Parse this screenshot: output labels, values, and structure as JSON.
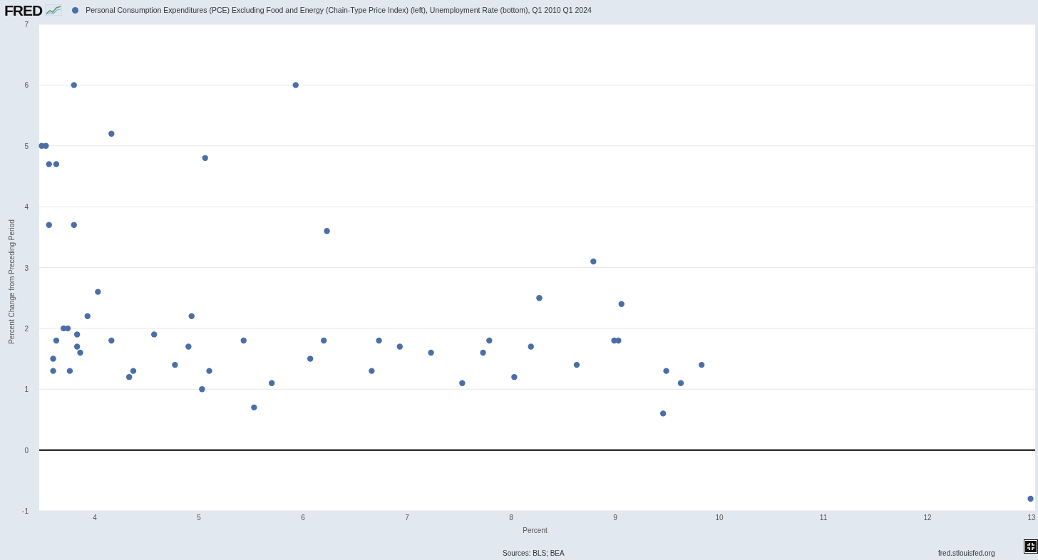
{
  "header": {
    "logo": "FRED",
    "legend": {
      "label": "Personal Consumption Expenditures (PCE) Excluding Food and Energy (Chain-Type Price Index) (left), Unemployment Rate (bottom), Q1 2010 Q1 2024",
      "color": "#4a6ea8"
    }
  },
  "chart_data": {
    "type": "scatter",
    "xlabel": "Percent",
    "ylabel": "Percent Change from Preceding Period",
    "xlim": [
      3.466,
      13.034
    ],
    "ylim": [
      -1,
      7
    ],
    "xticks": [
      4,
      5,
      6,
      7,
      8,
      9,
      10,
      11,
      12,
      13
    ],
    "yticks": [
      -1,
      0,
      1,
      2,
      3,
      4,
      5,
      6,
      7
    ],
    "grid": true,
    "x": [
      3.49,
      3.53,
      3.56,
      3.63,
      3.56,
      3.6,
      3.6,
      3.63,
      3.7,
      3.74,
      3.76,
      3.8,
      3.8,
      3.83,
      3.83,
      3.86,
      3.93,
      4.03,
      4.16,
      4.16,
      4.33,
      4.37,
      4.57,
      4.77,
      4.9,
      4.93,
      5.03,
      5.06,
      5.1,
      5.43,
      5.53,
      5.7,
      5.93,
      6.07,
      6.2,
      6.23,
      6.66,
      6.73,
      6.93,
      7.23,
      7.53,
      7.73,
      7.79,
      8.03,
      8.19,
      8.27,
      8.63,
      8.79,
      8.99,
      9.03,
      9.06,
      9.46,
      9.49,
      9.63,
      9.83,
      12.99
    ],
    "series": [
      {
        "color": "#4a6ea8",
        "values": [
          5.0,
          5.0,
          4.7,
          4.7,
          3.7,
          1.5,
          1.3,
          1.8,
          2.0,
          2.0,
          1.3,
          6.0,
          3.7,
          1.9,
          1.7,
          1.6,
          2.2,
          2.6,
          5.2,
          1.8,
          1.2,
          1.3,
          1.9,
          1.4,
          1.7,
          2.2,
          1.0,
          4.8,
          1.3,
          1.8,
          0.7,
          1.1,
          6.0,
          1.5,
          1.8,
          3.6,
          1.3,
          1.8,
          1.7,
          1.6,
          1.1,
          1.6,
          1.8,
          1.2,
          1.7,
          2.5,
          1.4,
          3.1,
          1.8,
          1.8,
          2.4,
          0.6,
          1.3,
          1.1,
          1.4,
          -0.8
        ]
      }
    ]
  },
  "footer": {
    "sources": "Sources: BLS; BEA",
    "site": "fred.stlouisfed.org"
  }
}
